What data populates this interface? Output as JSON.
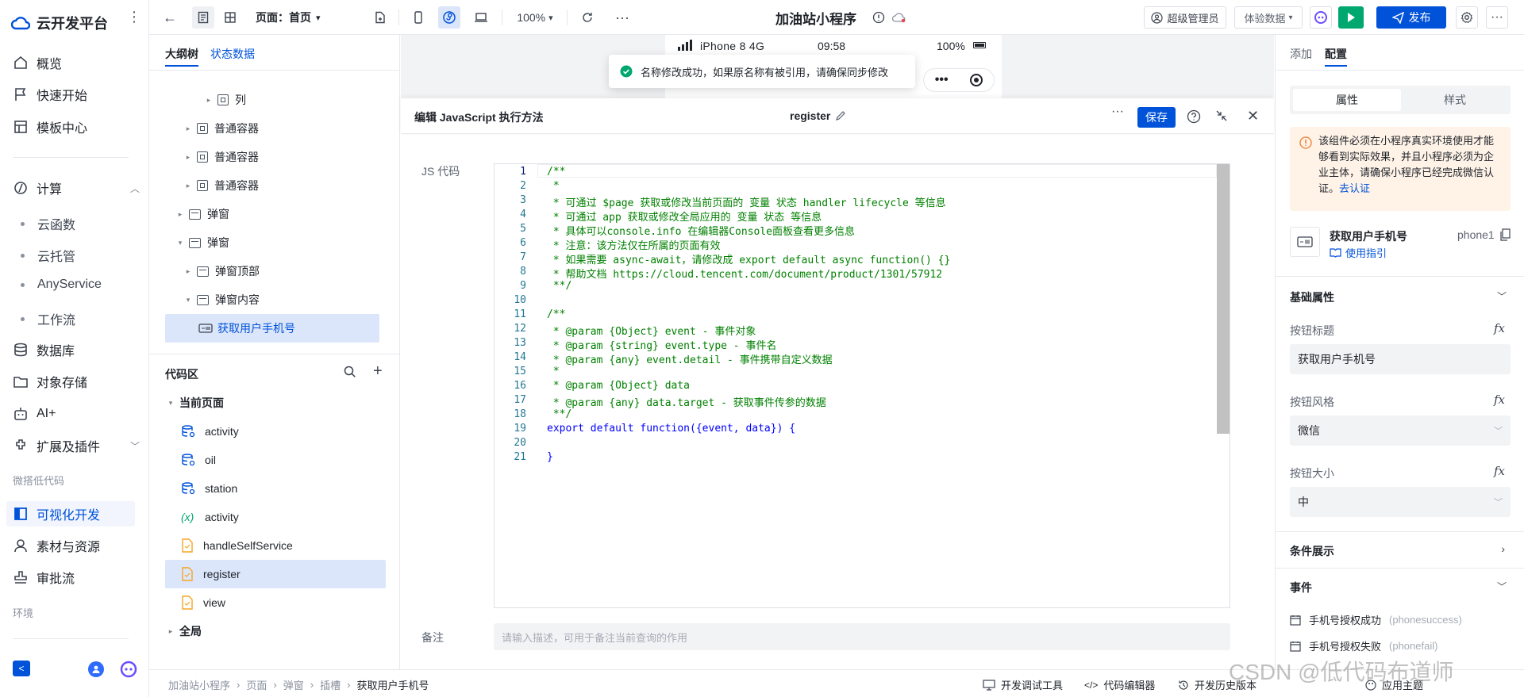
{
  "nav": {
    "brand": "云开发平台",
    "items": [
      {
        "label": "概览",
        "icon": "home-icon"
      },
      {
        "label": "快速开始",
        "icon": "flag-icon"
      },
      {
        "label": "模板中心",
        "icon": "template-icon"
      }
    ],
    "compute": {
      "label": "计算",
      "icon": "compute-icon",
      "children": [
        "云函数",
        "云托管",
        "AnyService",
        "工作流"
      ]
    },
    "items2": [
      {
        "label": "数据库",
        "icon": "database-icon"
      },
      {
        "label": "对象存储",
        "icon": "storage-icon"
      },
      {
        "label": "AI+",
        "icon": "robot-icon"
      },
      {
        "label": "扩展及插件",
        "icon": "plugin-icon"
      }
    ],
    "lowcode_heading": "微搭低代码",
    "items3": [
      {
        "label": "可视化开发",
        "icon": "visual-dev-icon",
        "active": true
      },
      {
        "label": "素材与资源",
        "icon": "assets-icon"
      },
      {
        "label": "审批流",
        "icon": "approval-icon"
      }
    ],
    "env_heading": "环境"
  },
  "topbar": {
    "page_selector": "页面：首页",
    "zoom": "100%",
    "app_title": "加油站小程序",
    "user": "超级管理员",
    "data_mode": "体验数据",
    "publish": "发布"
  },
  "phone": {
    "device": "iPhone 8",
    "network": "4G",
    "time": "09:58",
    "battery": "100%"
  },
  "toast": {
    "message": "名称修改成功，如果原名称有被引用，请确保同步修改"
  },
  "outline": {
    "tabs": [
      "大纲树",
      "状态数据"
    ],
    "tree": [
      {
        "label": "列",
        "type": "box"
      },
      {
        "label": "普通容器",
        "type": "box"
      },
      {
        "label": "普通容器",
        "type": "box"
      },
      {
        "label": "普通容器",
        "type": "box"
      },
      {
        "label": "弹窗",
        "type": "window"
      },
      {
        "label": "弹窗",
        "type": "window"
      },
      {
        "label": "弹窗顶部",
        "type": "window"
      },
      {
        "label": "弹窗内容",
        "type": "window"
      },
      {
        "label": "获取用户手机号",
        "type": "phone"
      }
    ],
    "code_area_title": "代码区",
    "current_page": "当前页面",
    "code_items": [
      {
        "label": "activity",
        "kind": "database"
      },
      {
        "label": "oil",
        "kind": "database"
      },
      {
        "label": "station",
        "kind": "database"
      },
      {
        "label": "activity",
        "kind": "variable"
      },
      {
        "label": "handleSelfService",
        "kind": "file"
      },
      {
        "label": "register",
        "kind": "file"
      },
      {
        "label": "view",
        "kind": "file"
      }
    ],
    "global": "全局"
  },
  "editor": {
    "title": "编辑 JavaScript 执行方法",
    "method_name": "register",
    "save": "保存",
    "js_label": "JS 代码",
    "note_label": "备注",
    "note_placeholder": "请输入描述，可用于备注当前查询的作用",
    "code_lines": [
      "/**",
      " *",
      " * 可通过 $page 获取或修改当前页面的 变量 状态 handler lifecycle 等信息",
      " * 可通过 app 获取或修改全局应用的 变量 状态 等信息",
      " * 具体可以console.info 在编辑器Console面板查看更多信息",
      " * 注意：该方法仅在所属的页面有效",
      " * 如果需要 async-await，请修改成 export default async function() {}",
      " * 帮助文档 https://cloud.tencent.com/document/product/1301/57912",
      " **/",
      "",
      "/**",
      " * @param {Object} event - 事件对象",
      " * @param {string} event.type - 事件名",
      " * @param {any} event.detail - 事件携带自定义数据",
      " *",
      " * @param {Object} data",
      " * @param {any} data.target - 获取事件传参的数据",
      " **/",
      "export default function({event, data}) {",
      "",
      "}"
    ]
  },
  "right": {
    "tabs": [
      "添加",
      "配置"
    ],
    "seg": [
      "属性",
      "样式"
    ],
    "notice": "该组件必须在小程序真实环境使用才能够看到实际效果，并且小程序必须为企业主体，请确保小程序已经完成微信认证。",
    "notice_link": "去认证",
    "component_name": "获取用户手机号",
    "component_id": "phone1",
    "guide": "使用指引",
    "basic_props": "基础属性",
    "fields": [
      {
        "label": "按钮标题",
        "value": "获取用户手机号"
      },
      {
        "label": "按钮风格",
        "value": "微信"
      },
      {
        "label": "按钮大小",
        "value": "中"
      }
    ],
    "cond_display": "条件展示",
    "events_title": "事件",
    "events": [
      {
        "label": "手机号授权成功",
        "code": "(phonesuccess)"
      },
      {
        "label": "手机号授权失败",
        "code": "(phonefail)"
      }
    ]
  },
  "footer": {
    "breadcrumb": [
      "加油站小程序",
      "页面",
      "弹窗",
      "插槽",
      "获取用户手机号"
    ],
    "tools": [
      "开发调试工具",
      "代码编辑器",
      "开发历史版本",
      "应用主题"
    ]
  },
  "watermark": "CSDN @低代码布道师",
  "colors": {
    "accent": "#0052d9",
    "green": "#00a870",
    "selected_bg": "#dbe6fb",
    "notice_bg": "#fff3e8",
    "code_green": "#008000"
  }
}
